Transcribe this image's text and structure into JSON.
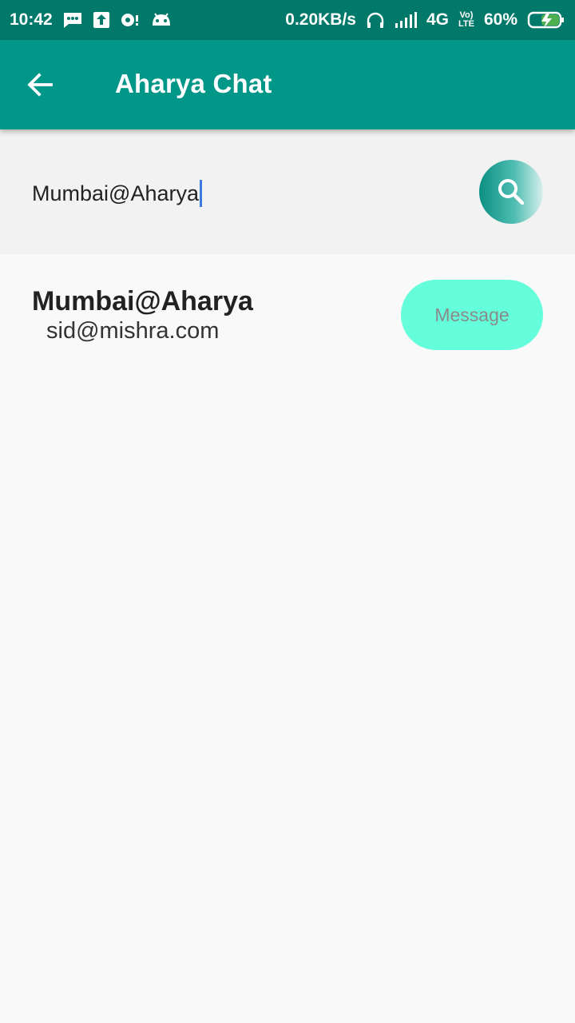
{
  "status_bar": {
    "time": "10:42",
    "network_speed": "0.20KB/s",
    "network_type": "4G",
    "volte_top": "Vo)",
    "volte_bottom": "LTE",
    "battery": "60%",
    "icons": [
      "message-icon",
      "upload-icon",
      "sync-icon",
      "android-icon",
      "headset-icon",
      "signal-icon",
      "battery-charging-icon"
    ]
  },
  "app_bar": {
    "title": "Aharya Chat",
    "back_icon": "arrow-back-icon"
  },
  "search": {
    "query": "Mumbai@Aharya",
    "button_icon": "search-icon"
  },
  "results": [
    {
      "name": "Mumbai@Aharya",
      "email": "sid@mishra.com",
      "action_label": "Message"
    }
  ],
  "colors": {
    "status_bar": "#00796b",
    "app_bar": "#009688",
    "message_button": "#64ffda",
    "caret": "#3d7be0"
  }
}
